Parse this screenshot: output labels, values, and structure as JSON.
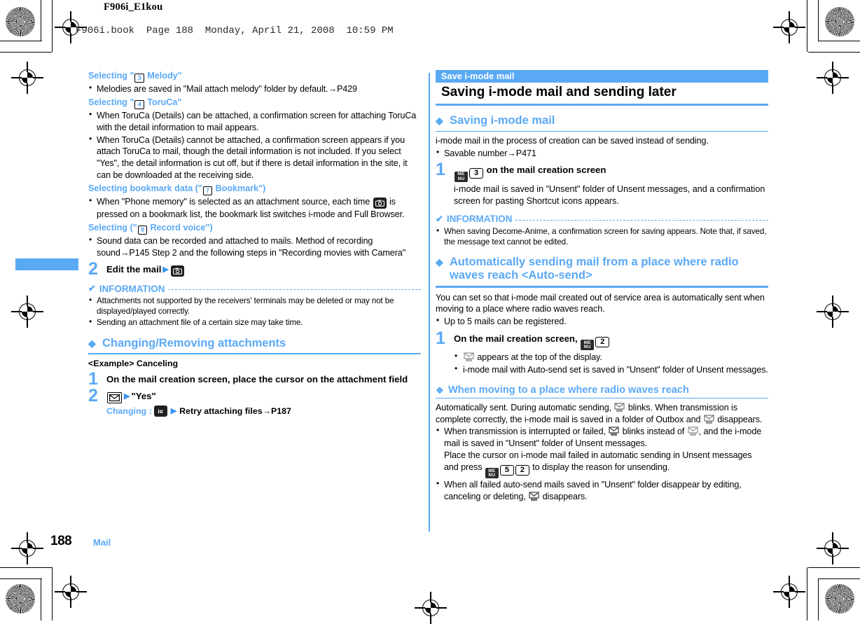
{
  "page": {
    "doc_id": "F906i_E1kou",
    "book_line": "F906i.book  Page 188  Monday, April 21, 2008  10:59 PM",
    "footer_number": "188",
    "footer_section": "Mail",
    "accent_color": "#5aa9f5"
  },
  "left_column": {
    "section_melody": {
      "heading_prefix": "Selecting \"",
      "heading_key": "3",
      "heading_suffix": " Melody\"",
      "bullets": [
        "Melodies are saved in \"Mail attach melody\" folder by default.→P429"
      ]
    },
    "section_toruca": {
      "heading_prefix": "Selecting \"",
      "heading_key": "4",
      "heading_suffix": " ToruCa\"",
      "bullets": [
        "When ToruCa (Details) can be attached, a confirmation screen for attaching ToruCa with the detail information to mail appears.",
        "When ToruCa (Details) cannot be attached, a confirmation screen appears if you attach ToruCa to mail, though the detail information is not included. If you select \"Yes\", the detail information is cut off, but if there is detail information in the site, it can be downloaded at the receiving side."
      ]
    },
    "section_bookmark": {
      "heading_prefix": "Selecting bookmark data (\"",
      "heading_key": "7",
      "heading_suffix": " Bookmark\")",
      "bullet_part1": "When \"Phone memory\" is selected as an attachment source, each time",
      "bullet_part2": "is pressed on a bookmark list, the bookmark list switches i-mode and Full Browser."
    },
    "section_record": {
      "heading_prefix": "Selecting (\"",
      "heading_key": "9",
      "heading_suffix": " Record voice\")",
      "bullets": [
        "Sound data can be recorded and attached to mails. Method of recording sound→P145 Step 2 and the following steps in \"Recording movies with Camera\""
      ]
    },
    "step2": {
      "number": "2",
      "title": "Edit the mail"
    },
    "information": {
      "label": "INFORMATION",
      "bullets": [
        "Attachments not supported by the receivers' terminals may be deleted or may not be displayed/played correctly.",
        "Sending an attachment file of a certain size may take time."
      ]
    },
    "changing_heading": "Changing/Removing attachments",
    "example_label": "<Example> Canceling",
    "step1": {
      "number": "1",
      "title": "On the mail creation screen, place the cursor on the attachment field"
    },
    "step2b": {
      "number": "2",
      "yes_label": "\"Yes\"",
      "changing_label": "Changing :",
      "changing_text": "Retry attaching files→P187"
    }
  },
  "right_column": {
    "banner_label": "Save i-mode mail",
    "banner_title": "Saving i-mode mail and sending later",
    "saving_heading": "Saving i-mode mail",
    "saving_intro": "i-mode mail in the process of creation can be saved instead of sending.",
    "saving_bullets": [
      "Savable number→P471"
    ],
    "step1": {
      "number": "1",
      "key_menu": "MENU",
      "key_num": "3",
      "title_suffix": "on the mail creation screen",
      "body": "i-mode mail is saved in \"Unsent\" folder of Unsent messages, and a confirmation screen for pasting Shortcut icons appears."
    },
    "information": {
      "label": "INFORMATION",
      "bullets": [
        "When saving Decome-Anime, a confirmation screen for saving appears. Note that, if saved, the message text cannot be edited."
      ]
    },
    "autosend_heading": "Automatically sending mail from a place where radio waves reach <Auto-send>",
    "autosend_intro": "You can set so that i-mode mail created out of service area is automatically sent when moving to a place where radio waves reach.",
    "autosend_bullets": [
      "Up to 5 mails can be registered."
    ],
    "step1b": {
      "number": "1",
      "title_prefix": "On the mail creation screen,",
      "key_menu": "MENU",
      "key_num": "2",
      "bullet1_suffix": "appears at the top of the display.",
      "bullet2": "i-mode mail with Auto-send set is saved in \"Unsent\" folder of Unsent messages."
    },
    "moving_heading": "When moving to a place where radio waves reach",
    "moving_text_1": "Automatically sent. During automatic sending,",
    "moving_text_2": "blinks. When transmission is complete correctly, the i-mode mail is saved in a folder of Outbox and",
    "moving_text_3": "disappears.",
    "moving_bullet1_1": "When transmission is interrupted or failed,",
    "moving_bullet1_2": "blinks instead of",
    "moving_bullet1_3": ", and the i-mode mail is saved in \"Unsent\" folder of Unsent messages.",
    "moving_bullet1_4": "Place the cursor on i-mode mail failed in automatic sending in Unsent messages and press",
    "moving_bullet1_key1": "5",
    "moving_bullet1_key2": "2",
    "moving_bullet1_5": "to display the reason for unsending.",
    "moving_bullet2_1": "When all failed auto-send mails saved in \"Unsent\" folder disappear by editing, canceling or deleting,",
    "moving_bullet2_2": "disappears."
  }
}
